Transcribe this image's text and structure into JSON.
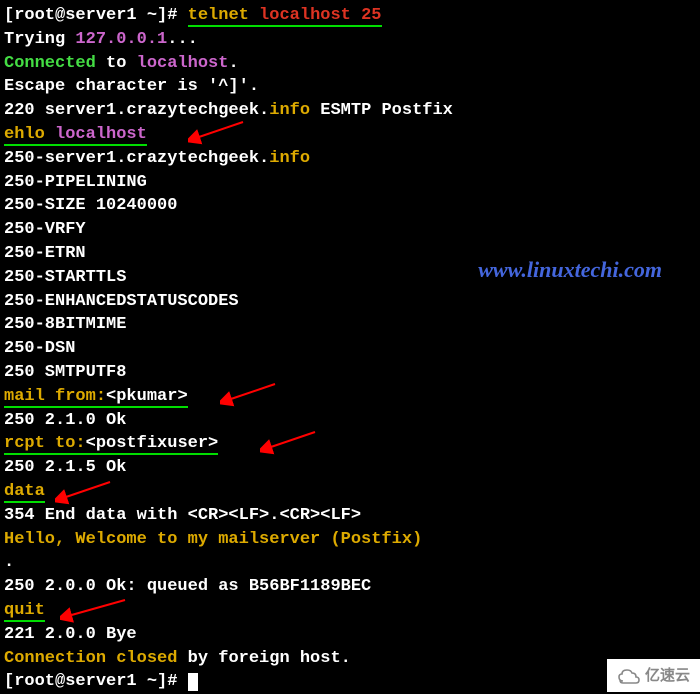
{
  "terminal": {
    "prompt1_user": "[root@server1 ~]# ",
    "cmd1_telnet": "telnet",
    "cmd1_host": " localhost",
    "cmd1_port": " 25",
    "trying": "Trying ",
    "trying_ip": "127.0.0.1",
    "trying_dots": "...",
    "connected_1": "Connected",
    "connected_2": " to ",
    "connected_3": "localhost",
    "connected_4": ".",
    "escape": "Escape character is '^]'.",
    "banner_1": "220 server1.crazytechgeek.",
    "banner_2": "info",
    "banner_3": " ESMTP Postfix",
    "ehlo_cmd": "ehlo ",
    "ehlo_host": "localhost",
    "r250_1": "250-server1.crazytechgeek.",
    "r250_1b": "info",
    "r250_2": "250-PIPELINING",
    "r250_3": "250-SIZE 10240000",
    "r250_4": "250-VRFY",
    "r250_5": "250-ETRN",
    "r250_6": "250-STARTTLS",
    "r250_7": "250-ENHANCEDSTATUSCODES",
    "r250_8": "250-8BITMIME",
    "r250_9": "250-DSN",
    "r250_10": "250 SMTPUTF8",
    "mailfrom_cmd": "mail from:",
    "mailfrom_addr": "<pkumar>",
    "ok1": "250 2.1.0 Ok",
    "rcpt_cmd": "rcpt to:",
    "rcpt_addr": "<postfixuser>",
    "ok2": "250 2.1.5 Ok",
    "data_cmd": "data",
    "data_resp": "354 End data with <CR><LF>.<CR><LF>",
    "msg_body": "Hello, Welcome to my mailserver (Postfix)",
    "dot": ".",
    "queued": "250 2.0.0 Ok: queued as B56BF1189BEC",
    "quit_cmd": "quit",
    "bye": "221 2.0.0 Bye",
    "closed_1": "Connection closed",
    "closed_2": " by foreign host.",
    "prompt2": "[root@server1 ~]# "
  },
  "watermark": "www.linuxtechi.com",
  "logo_text": "亿速云"
}
